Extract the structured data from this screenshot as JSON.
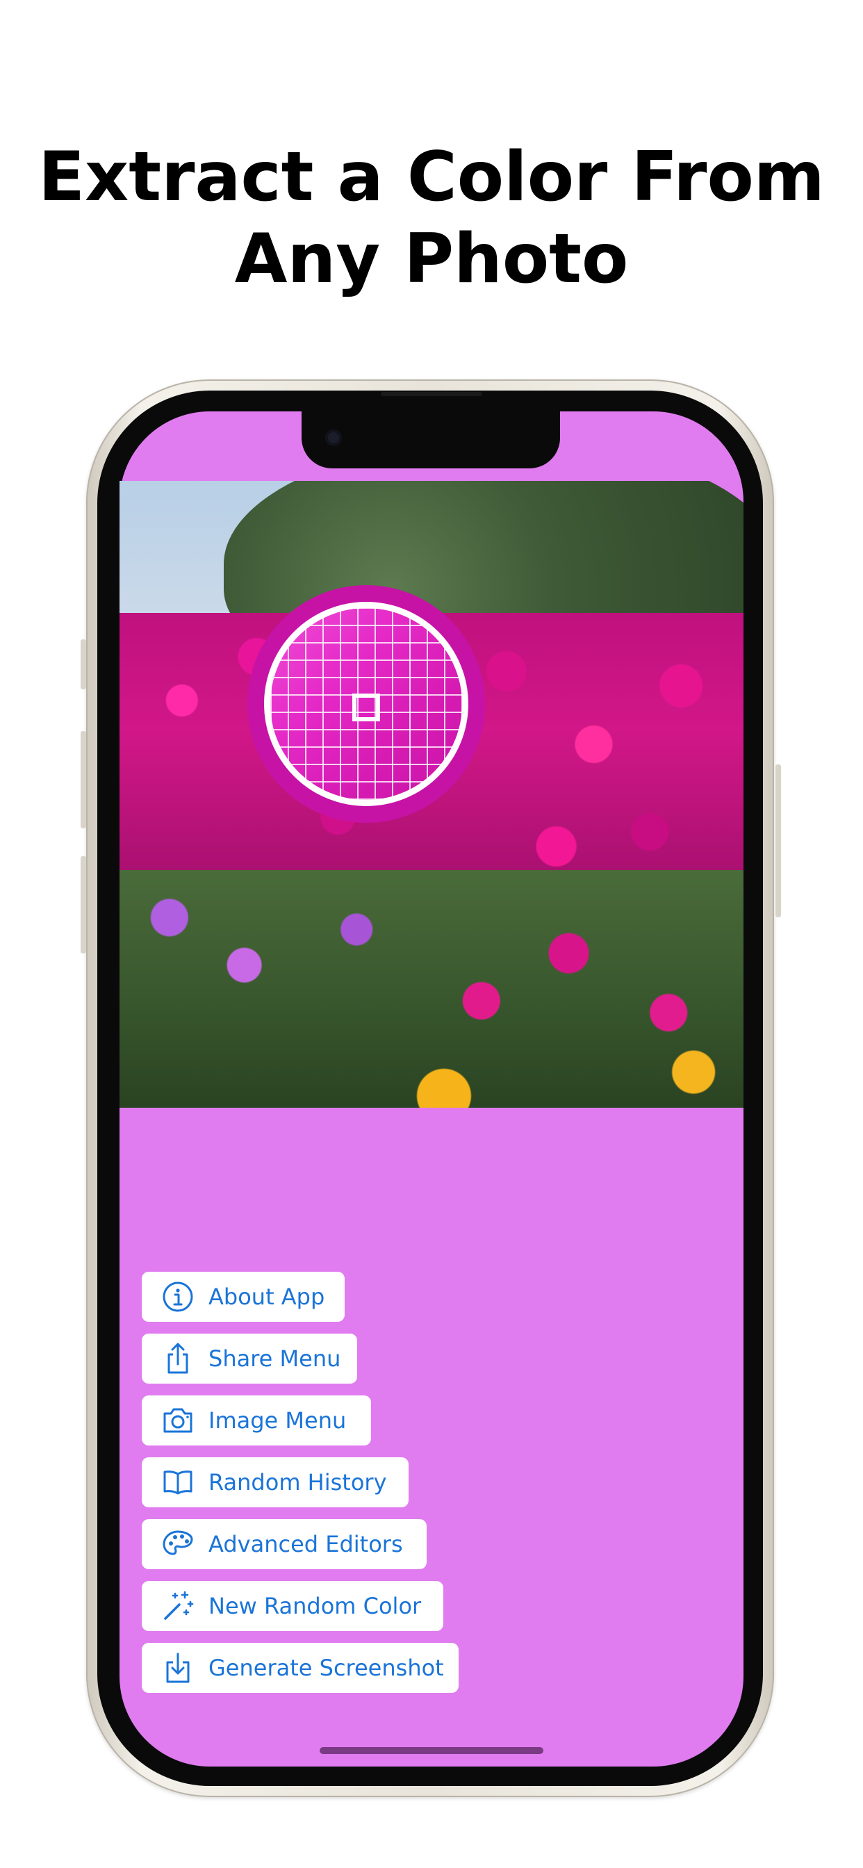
{
  "headline": {
    "line1": "Extract a Color From",
    "line2": "Any Photo"
  },
  "screen": {
    "background_color": "#e07cf0",
    "picker_ring_color": "#c712a6",
    "sampled_color": "#d81cb5"
  },
  "menu": {
    "items": [
      {
        "label": "About App",
        "icon": "info-circle-icon"
      },
      {
        "label": "Share Menu",
        "icon": "share-icon"
      },
      {
        "label": "Image Menu",
        "icon": "camera-icon"
      },
      {
        "label": "Random History",
        "icon": "book-icon"
      },
      {
        "label": "Advanced Editors",
        "icon": "palette-icon"
      },
      {
        "label": "New Random Color",
        "icon": "magic-wand-icon"
      },
      {
        "label": "Generate Screenshot",
        "icon": "download-tray-icon"
      }
    ],
    "text_color": "#1a74d8"
  }
}
